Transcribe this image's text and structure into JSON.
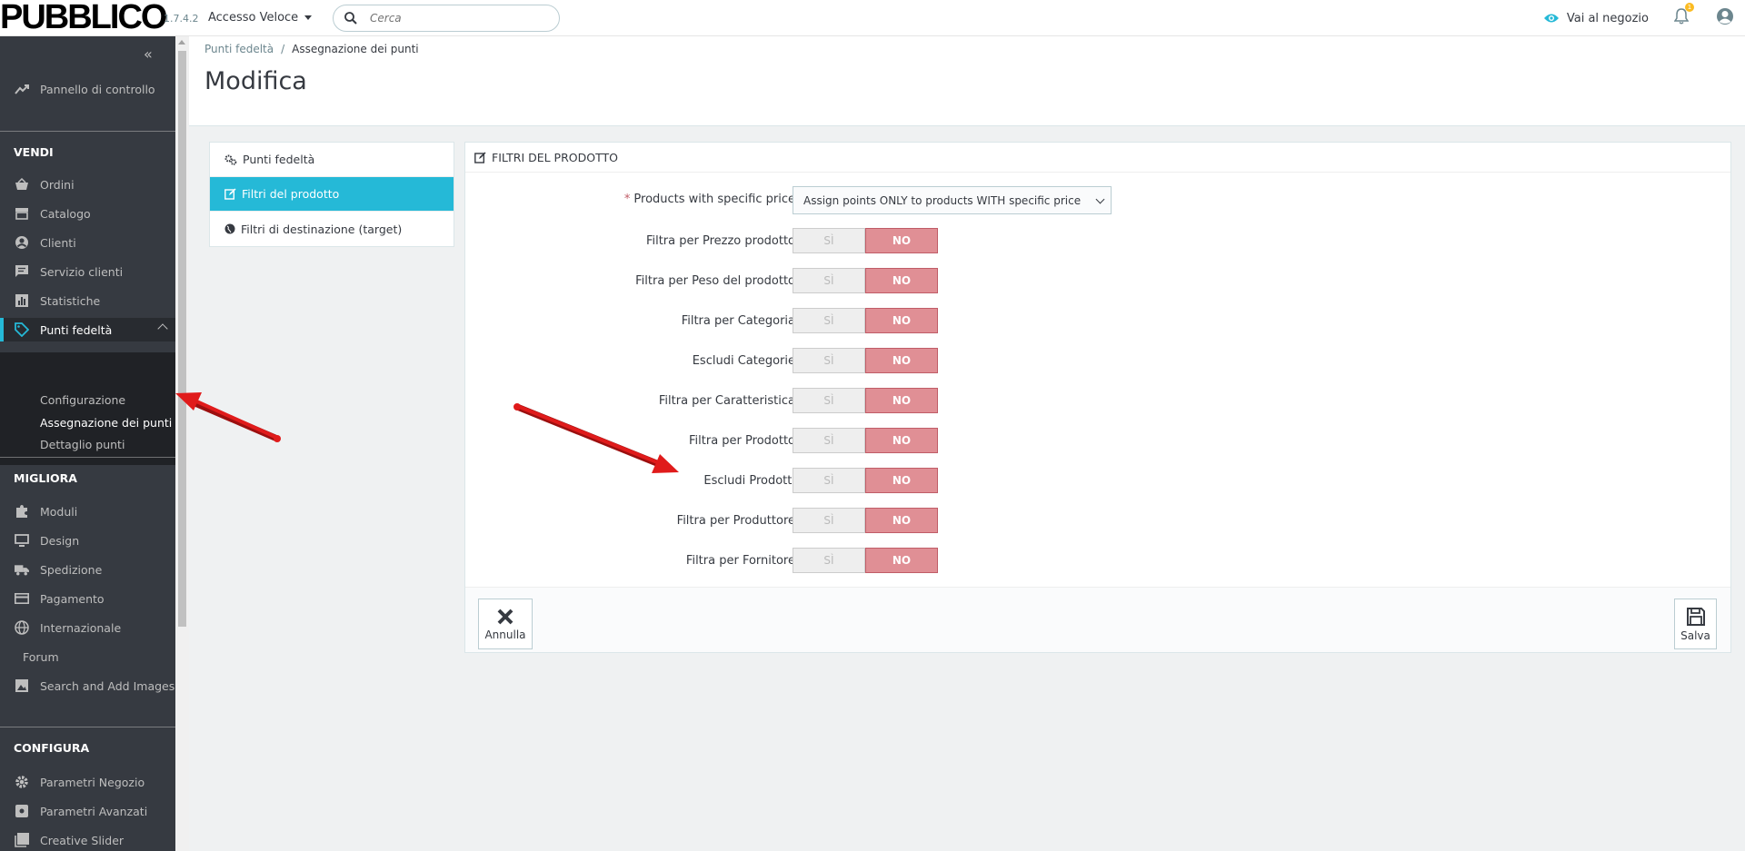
{
  "header": {
    "logo": "PUBBLICO",
    "version": "1.7.4.2",
    "quick_access": "Accesso Veloce",
    "search_placeholder": "Cerca",
    "shop_link": "Vai al negozio",
    "notification_count": "1"
  },
  "sidebar": {
    "dashboard": "Pannello di controllo",
    "sections": {
      "vendi": "VENDI",
      "migliora": "MIGLIORA",
      "configura": "CONFIGURA"
    },
    "vendi_items": [
      "Ordini",
      "Catalogo",
      "Clienti",
      "Servizio clienti",
      "Statistiche"
    ],
    "active_item": "Punti fedeltà",
    "sub_items": [
      "Configurazione",
      "Assegnazione dei punti",
      "Dettaglio punti"
    ],
    "migliora_items": [
      "Moduli",
      "Design",
      "Spedizione",
      "Pagamento",
      "Internazionale",
      "Forum",
      "Search and Add Images"
    ],
    "configura_items": [
      "Parametri Negozio",
      "Parametri Avanzati",
      "Creative Slider"
    ]
  },
  "page": {
    "breadcrumb_parent": "Punti fedeltà",
    "breadcrumb_sep": "/",
    "breadcrumb_current": "Assegnazione dei punti",
    "title": "Modifica"
  },
  "tabs": [
    "Punti fedeltà",
    "Filtri del prodotto",
    "Filtri di destinazione (target)"
  ],
  "panel": {
    "title": "FILTRI DEL PRODOTTO",
    "specific_price_label": "Products with specific price",
    "specific_price_value": "Assign points ONLY to products WITH specific price",
    "yes_label": "SÌ",
    "no_label": "NO",
    "filters": [
      "Filtra per Prezzo prodotto",
      "Filtra per Peso del prodotto",
      "Filtra per Categoria",
      "Escludi Categorie",
      "Filtra per Caratteristica",
      "Filtra per Prodotto",
      "Escludi Prodotti",
      "Filtra per Produttore",
      "Filtra per Fornitore"
    ],
    "cancel_label": "Annulla",
    "save_label": "Salva"
  },
  "colors": {
    "sidebar_bg": "#363a41",
    "accent": "#25b9d7",
    "no_active": "#e08f95",
    "annotation_arrow": "#e01b1b"
  }
}
